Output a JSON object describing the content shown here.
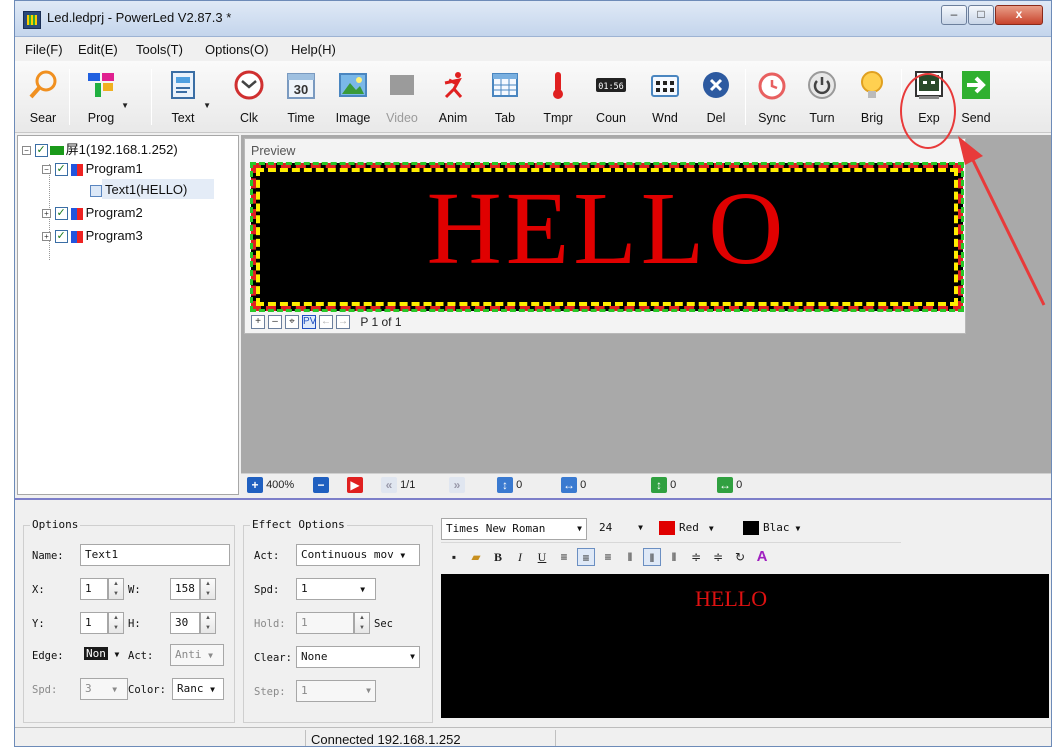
{
  "window": {
    "title": "Led.ledprj - PowerLed V2.87.3 *",
    "min": "–",
    "max": "□",
    "close": "x"
  },
  "menu": [
    "File(F)",
    "Edit(E)",
    "Tools(T)",
    "Options(O)",
    "Help(H)"
  ],
  "toolbar": [
    {
      "label": "Sear",
      "icon": "search-icon"
    },
    {
      "label": "Prog",
      "icon": "program-icon"
    },
    {
      "label": "Text",
      "icon": "text-icon"
    },
    {
      "label": "Clk",
      "icon": "clock-icon"
    },
    {
      "label": "Time",
      "icon": "calendar-icon"
    },
    {
      "label": "Image",
      "icon": "image-icon"
    },
    {
      "label": "Video",
      "icon": "video-icon",
      "disabled": true
    },
    {
      "label": "Anim",
      "icon": "animation-icon"
    },
    {
      "label": "Tab",
      "icon": "table-icon"
    },
    {
      "label": "Tmpr",
      "icon": "thermometer-icon"
    },
    {
      "label": "Coun",
      "icon": "counter-icon"
    },
    {
      "label": "Wnd",
      "icon": "window-icon"
    },
    {
      "label": "Del",
      "icon": "delete-icon"
    },
    {
      "label": "Sync",
      "icon": "alarm-icon"
    },
    {
      "label": "Turn",
      "icon": "power-icon"
    },
    {
      "label": "Brig",
      "icon": "bulb-icon"
    },
    {
      "label": "Exp",
      "icon": "export-icon"
    },
    {
      "label": "Send",
      "icon": "send-arrow-icon"
    }
  ],
  "counter_icon_text": "01:56",
  "calendar_icon_text": "30",
  "tree": {
    "screen": "屏1(192.168.1.252)",
    "program1": "Program1",
    "text1": "Text1(HELLO)",
    "program2": "Program2",
    "program3": "Program3"
  },
  "preview": {
    "label": "Preview",
    "led_text": "HELLO",
    "page": "P 1 of 1",
    "buttons": [
      "+",
      "–",
      "⌖",
      "PV",
      "←",
      "→"
    ]
  },
  "bottom": {
    "zoom": "400%",
    "page_frac": "1/1",
    "v_offset": "0",
    "h_offset": "0",
    "v2": "0",
    "h2": "0"
  },
  "options": {
    "title": "Options",
    "name_label": "Name:",
    "name_value": "Text1",
    "x_label": "X:",
    "x_value": "1",
    "w_label": "W:",
    "w_value": "158",
    "y_label": "Y:",
    "y_value": "1",
    "h_label": "H:",
    "h_value": "30",
    "edge_label": "Edge:",
    "edge_value": "Non",
    "act_label": "Act:",
    "act_value": "Anti",
    "spd_label": "Spd:",
    "spd_value": "3",
    "color_label": "Color:",
    "color_value": "Ranc"
  },
  "effect": {
    "title": "Effect Options",
    "act_label": "Act:",
    "act_value": "Continuous mov",
    "spd_label": "Spd:",
    "spd_value": "1",
    "hold_label": "Hold:",
    "hold_value": "1",
    "hold_unit": "Sec",
    "clear_label": "Clear:",
    "clear_value": "None",
    "step_label": "Step:",
    "step_value": "1"
  },
  "editor": {
    "font": "Times New Roman",
    "size": "24",
    "fg_label": "Red",
    "fg_color": "#e00000",
    "bg_label": "Blac",
    "bg_color": "#000000",
    "text": "HELLO",
    "tools": [
      "💾",
      "📂",
      "B",
      "I",
      "U",
      "≡",
      "≡",
      "≡",
      "‖",
      "‖",
      "‖",
      "≠",
      "≠",
      "↻",
      "A"
    ]
  },
  "status": {
    "text": "Connected 192.168.1.252"
  },
  "colors": {
    "accent_circle": "#e83a3a",
    "led_red": "#e00000"
  }
}
